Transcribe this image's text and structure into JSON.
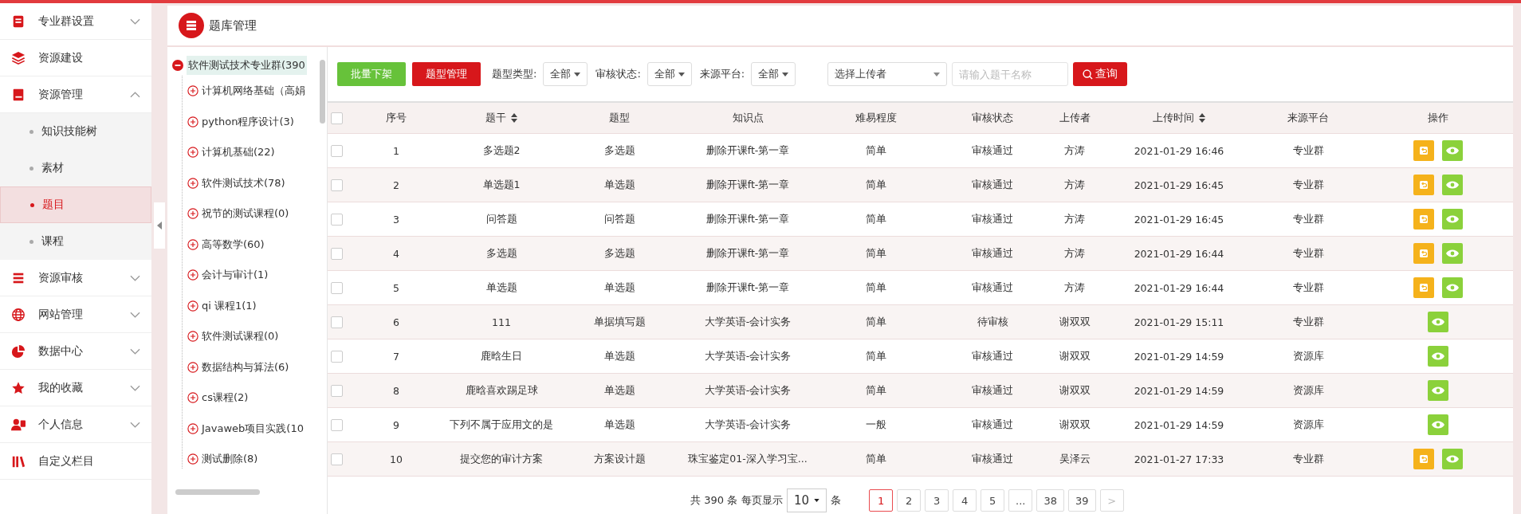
{
  "sidebar": {
    "items": [
      {
        "label": "专业群设置",
        "expanded": false
      },
      {
        "label": "资源建设"
      },
      {
        "label": "资源管理",
        "expanded": true,
        "children": [
          {
            "label": "知识技能树",
            "selected": false
          },
          {
            "label": "素材",
            "selected": false
          },
          {
            "label": "题目",
            "selected": true
          },
          {
            "label": "课程",
            "selected": false
          }
        ]
      },
      {
        "label": "资源审核",
        "expanded": false
      },
      {
        "label": "网站管理",
        "expanded": false
      },
      {
        "label": "数据中心",
        "expanded": false
      },
      {
        "label": "我的收藏",
        "expanded": false
      },
      {
        "label": "个人信息",
        "expanded": false
      },
      {
        "label": "自定义栏目"
      }
    ]
  },
  "panel": {
    "title": "题库管理"
  },
  "tree": {
    "label": "软件测试技术专业群(390",
    "expanded": true,
    "selected": true,
    "children": [
      {
        "label": "计算机网络基础（高娟",
        "expanded": false
      },
      {
        "label": "python程序设计(3)",
        "expanded": false
      },
      {
        "label": "计算机基础(22)",
        "expanded": false
      },
      {
        "label": "软件测试技术(78)",
        "expanded": false
      },
      {
        "label": "祝节的测试课程(0)",
        "expanded": false
      },
      {
        "label": "高等数学(60)",
        "expanded": false
      },
      {
        "label": "会计与审计(1)",
        "expanded": false
      },
      {
        "label": "qi 课程1(1)",
        "expanded": false
      },
      {
        "label": "软件测试课程(0)",
        "expanded": false
      },
      {
        "label": "数据结构与算法(6)",
        "expanded": false
      },
      {
        "label": "cs课程(2)",
        "expanded": false
      },
      {
        "label": "Javaweb项目实践(10",
        "expanded": false
      },
      {
        "label": "测试删除(8)",
        "expanded": false
      }
    ]
  },
  "toolbar": {
    "buttons": [
      {
        "label": "批量下架",
        "color": "#67c23a"
      },
      {
        "label": "题型管理",
        "color": "#d7171b"
      }
    ],
    "filters": [
      {
        "label": "题型类型:",
        "value": "全部"
      },
      {
        "label": "审核状态:",
        "value": "全部"
      },
      {
        "label": "来源平台:",
        "value": "全部"
      }
    ],
    "uploader": {
      "placeholder": "选择上传者"
    },
    "search": {
      "placeholder": "请输入题干名称"
    },
    "query_button": "查询"
  },
  "table": {
    "header_checked": false,
    "columns": [
      {
        "label": "序号",
        "sortable": false
      },
      {
        "label": "题干",
        "sortable": true
      },
      {
        "label": "题型",
        "sortable": false
      },
      {
        "label": "知识点",
        "sortable": false
      },
      {
        "label": "难易程度",
        "sortable": false
      },
      {
        "label": "审核状态",
        "sortable": false
      },
      {
        "label": "上传者",
        "sortable": false
      },
      {
        "label": "上传时间",
        "sortable": true
      },
      {
        "label": "来源平台",
        "sortable": false
      },
      {
        "label": "操作",
        "sortable": false
      }
    ],
    "rows": [
      {
        "checked": false,
        "cells": [
          "1",
          "多选题2",
          "多选题",
          "删除开课ft-第一章",
          "简单",
          "审核通过",
          "方涛",
          "2021-01-29 16:46",
          "专业群"
        ],
        "actions": [
          {
            "kind": "undo"
          },
          {
            "kind": "view"
          }
        ]
      },
      {
        "checked": false,
        "cells": [
          "2",
          "单选题1",
          "单选题",
          "删除开课ft-第一章",
          "简单",
          "审核通过",
          "方涛",
          "2021-01-29 16:45",
          "专业群"
        ],
        "actions": [
          {
            "kind": "undo"
          },
          {
            "kind": "view"
          }
        ]
      },
      {
        "checked": false,
        "cells": [
          "3",
          "问答题",
          "问答题",
          "删除开课ft-第一章",
          "简单",
          "审核通过",
          "方涛",
          "2021-01-29 16:45",
          "专业群"
        ],
        "actions": [
          {
            "kind": "undo"
          },
          {
            "kind": "view"
          }
        ]
      },
      {
        "checked": false,
        "cells": [
          "4",
          "多选题",
          "多选题",
          "删除开课ft-第一章",
          "简单",
          "审核通过",
          "方涛",
          "2021-01-29 16:44",
          "专业群"
        ],
        "actions": [
          {
            "kind": "undo"
          },
          {
            "kind": "view"
          }
        ]
      },
      {
        "checked": false,
        "cells": [
          "5",
          "单选题",
          "单选题",
          "删除开课ft-第一章",
          "简单",
          "审核通过",
          "方涛",
          "2021-01-29 16:44",
          "专业群"
        ],
        "actions": [
          {
            "kind": "undo"
          },
          {
            "kind": "view"
          }
        ]
      },
      {
        "checked": false,
        "cells": [
          "6",
          "111",
          "单据填写题",
          "大学英语-会计实务",
          "简单",
          "待审核",
          "谢双双",
          "2021-01-29 15:11",
          "专业群"
        ],
        "actions": [
          {
            "kind": "view"
          }
        ]
      },
      {
        "checked": false,
        "cells": [
          "7",
          "鹿晗生日",
          "单选题",
          "大学英语-会计实务",
          "简单",
          "审核通过",
          "谢双双",
          "2021-01-29 14:59",
          "资源库"
        ],
        "actions": [
          {
            "kind": "view"
          }
        ]
      },
      {
        "checked": false,
        "cells": [
          "8",
          "鹿晗喜欢踢足球",
          "单选题",
          "大学英语-会计实务",
          "简单",
          "审核通过",
          "谢双双",
          "2021-01-29 14:59",
          "资源库"
        ],
        "actions": [
          {
            "kind": "view"
          }
        ]
      },
      {
        "checked": false,
        "cells": [
          "9",
          "下列不属于应用文的是",
          "单选题",
          "大学英语-会计实务",
          "一般",
          "审核通过",
          "谢双双",
          "2021-01-29 14:59",
          "资源库"
        ],
        "actions": [
          {
            "kind": "view"
          }
        ]
      },
      {
        "checked": false,
        "cells": [
          "10",
          "提交您的审计方案",
          "方案设计题",
          "珠宝鉴定01-深入学习宝...",
          "简单",
          "审核通过",
          "吴泽云",
          "2021-01-27 17:33",
          "专业群"
        ],
        "actions": [
          {
            "kind": "undo"
          },
          {
            "kind": "view"
          }
        ]
      }
    ]
  },
  "pagination": {
    "total": "共 390 条",
    "per_page_label": "每页显示",
    "per_page": "10",
    "unit": "条",
    "pages": [
      {
        "label": "1",
        "selected": true
      },
      {
        "label": "2",
        "selected": false
      },
      {
        "label": "3",
        "selected": false
      },
      {
        "label": "4",
        "selected": false
      },
      {
        "label": "5",
        "selected": false
      },
      {
        "label": "...",
        "selected": false
      },
      {
        "label": "38",
        "selected": false
      },
      {
        "label": "39",
        "selected": false
      }
    ],
    "next": {
      "label": ">",
      "disabled": true
    }
  }
}
